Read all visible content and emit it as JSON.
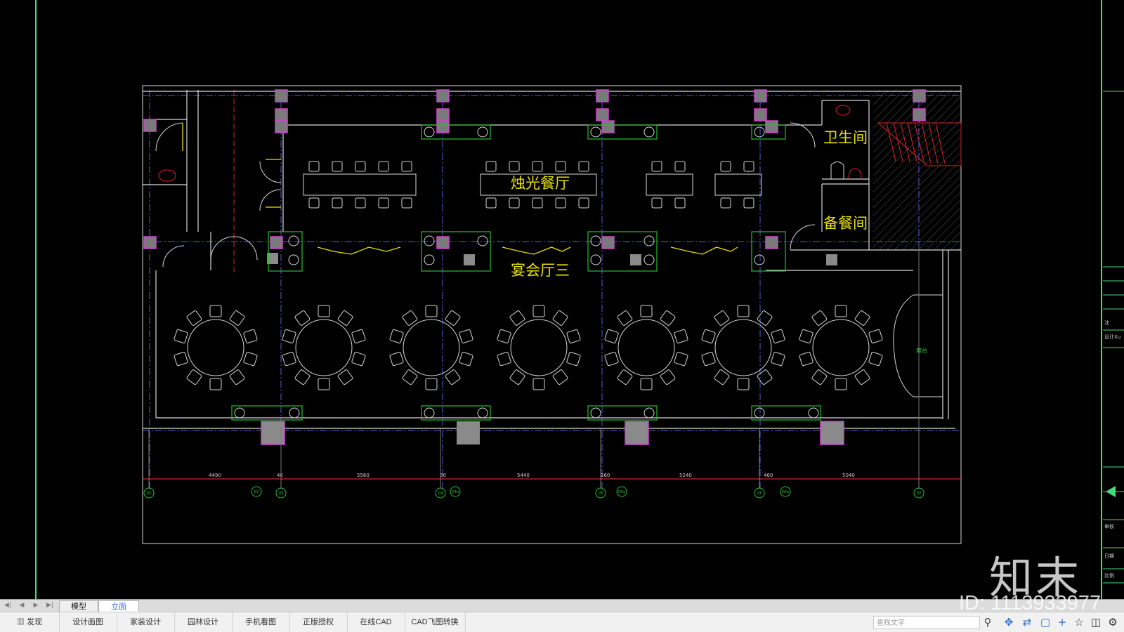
{
  "drawing": {
    "room_labels": {
      "candle_dining": "烛光餐厅",
      "banquet_hall": "宴会厅三",
      "restroom": "卫生间",
      "pantry": "备餐间",
      "stage": "舞台"
    },
    "dimensions": [
      "4490",
      "40",
      "5560",
      "60",
      "5440",
      "260",
      "5240",
      "460",
      "5040"
    ],
    "axis_tags": [
      "D1",
      "D2",
      "D3",
      "D4",
      "D4a",
      "D5",
      "D5a",
      "D6",
      "D6a",
      "D7"
    ],
    "title_block_texts": [
      "注",
      "设计",
      "Xu",
      "审核",
      "日期",
      "比例"
    ]
  },
  "tabs": {
    "model": "模型",
    "layout": "立面"
  },
  "toolbar": {
    "discover": "发现",
    "design_drawing": "设计画图",
    "home_design": "家装设计",
    "garden_design": "园林设计",
    "mobile_view": "手机看图",
    "license": "正版授权",
    "online_cad": "在线CAD",
    "cad_convert": "CAD飞图转换",
    "search_placeholder": "查找文字"
  },
  "watermark": {
    "logo": "知末",
    "id_text": "ID: 1113933977"
  },
  "colors": {
    "background": "#000000",
    "wall": "#d8d8d8",
    "grid_axis": "#5b5bd6",
    "column_fill": "#cc44cc",
    "green_frame": "#22c22c",
    "text_yellow": "#e8e000",
    "dim_line_red": "#e02020"
  }
}
